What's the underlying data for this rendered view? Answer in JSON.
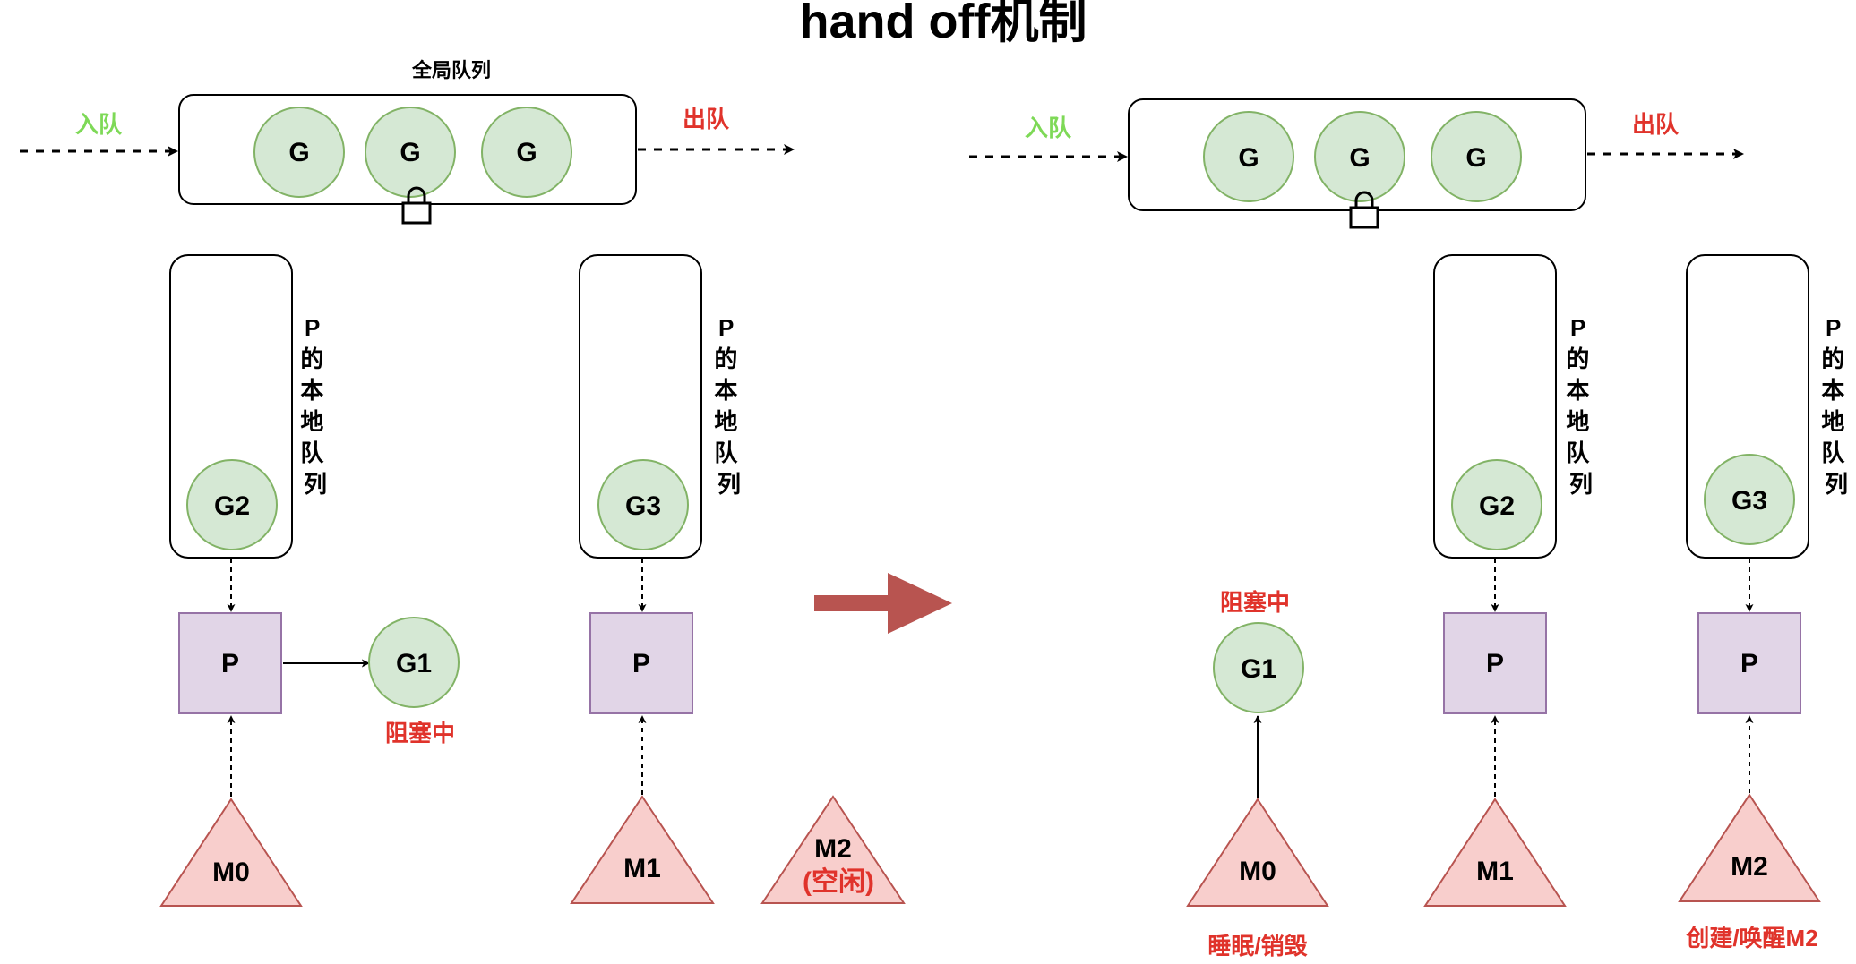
{
  "title": "hand off机制",
  "colors": {
    "green_text": "#7ed957",
    "red_text": "#e0332b",
    "g_fill": "#d5e8d4",
    "g_stroke": "#82b366",
    "p_fill": "#e1d5e7",
    "p_stroke": "#9673a6",
    "m_fill": "#f8cecc",
    "m_stroke": "#b85450",
    "big_arrow": "#b85450"
  },
  "before": {
    "global_queue": {
      "label": "全局队列",
      "enqueue": "入队",
      "dequeue": "出队",
      "items": [
        "G",
        "G",
        "G"
      ]
    },
    "local_queues": [
      {
        "label": "P的本地队列",
        "goroutine": "G2",
        "processor": "P",
        "machine": "M0"
      },
      {
        "label": "P的本地队列",
        "goroutine": "G3",
        "processor": "P",
        "machine": "M1"
      }
    ],
    "blocked_goroutine": "G1",
    "blocked_label": "阻塞中",
    "idle_machine": {
      "name": "M2",
      "status": "(空闲)"
    }
  },
  "after": {
    "global_queue": {
      "enqueue": "入队",
      "dequeue": "出队",
      "items": [
        "G",
        "G",
        "G"
      ]
    },
    "blocked_goroutine": "G1",
    "blocked_label": "阻塞中",
    "sleep_machine": {
      "name": "M0",
      "label": "睡眠/销毁"
    },
    "local_queues": [
      {
        "label": "P的本地队列",
        "goroutine": "G2",
        "processor": "P",
        "machine": "M1"
      },
      {
        "label": "P的本地队列",
        "goroutine": "G3",
        "processor": "P",
        "machine": "M2",
        "note": "创建/唤醒M2"
      }
    ]
  }
}
